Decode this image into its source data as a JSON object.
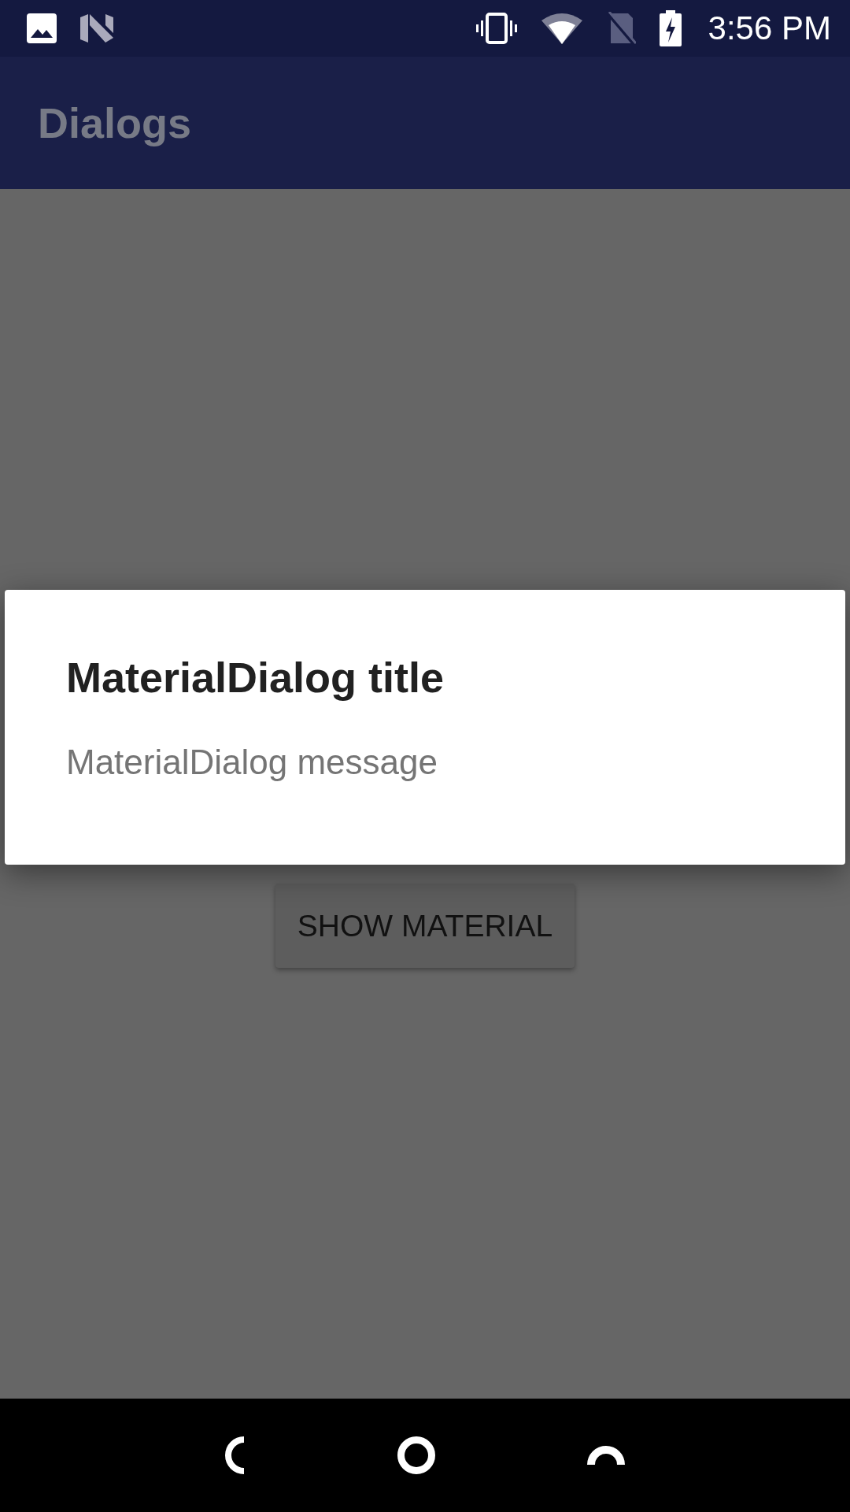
{
  "status_bar": {
    "time": "3:56 PM"
  },
  "app_bar": {
    "title": "Dialogs"
  },
  "content": {
    "button": {
      "label": "SHOW MATERIAL"
    }
  },
  "dialog": {
    "title": "MaterialDialog title",
    "message": "MaterialDialog message"
  }
}
